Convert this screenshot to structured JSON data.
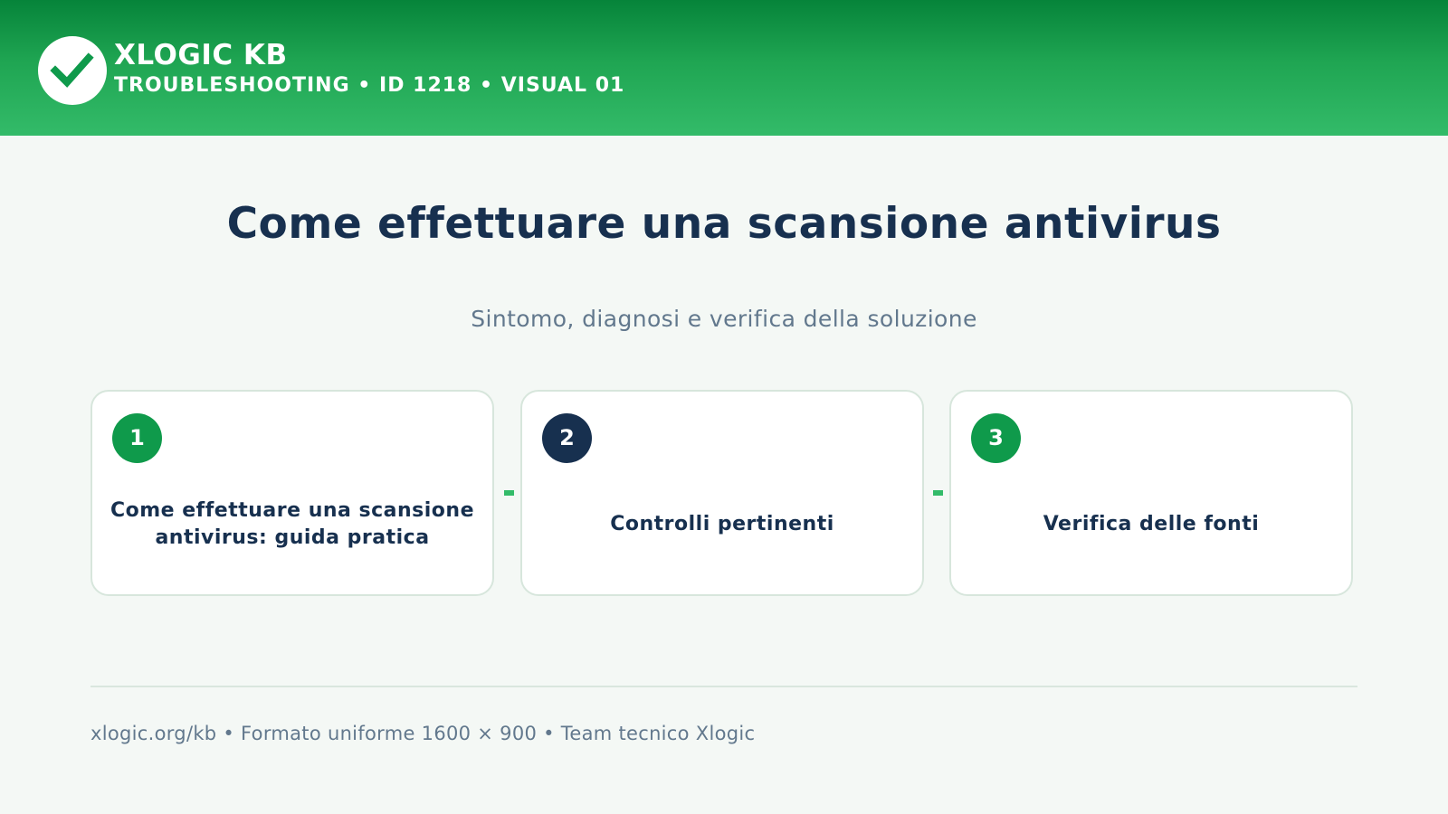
{
  "header": {
    "logo_icon": "checkmark-icon",
    "brand_name": "XLOGIC KB",
    "meta_line": "TROUBLESHOOTING • ID 1218 • VISUAL 01",
    "colors": {
      "gradient_top": "#06843a",
      "gradient_bottom": "#33bb69",
      "logo_background": "#ffffff",
      "checkmark": "#0f9a4b"
    }
  },
  "main": {
    "title": "Come effettuare una scansione antivirus",
    "subtitle": "Sintomo, diagnosi e verifica della soluzione",
    "steps": [
      {
        "number": "1",
        "label": "Come effettuare una scansione antivirus: guida pratica",
        "badge_color": "#0f9a4b"
      },
      {
        "number": "2",
        "label": "Controlli pertinenti",
        "badge_color": "#17304f"
      },
      {
        "number": "3",
        "label": "Verifica delle fonti",
        "badge_color": "#0f9a4b"
      }
    ]
  },
  "footer": {
    "text": "xlogic.org/kb • Formato uniforme 1600 × 900 • Team tecnico Xlogic"
  },
  "colors": {
    "background": "#f4f8f5",
    "title": "#17304f",
    "muted_text": "#62788d",
    "accent": "#33bb69",
    "card_border": "#d7e6dc"
  }
}
